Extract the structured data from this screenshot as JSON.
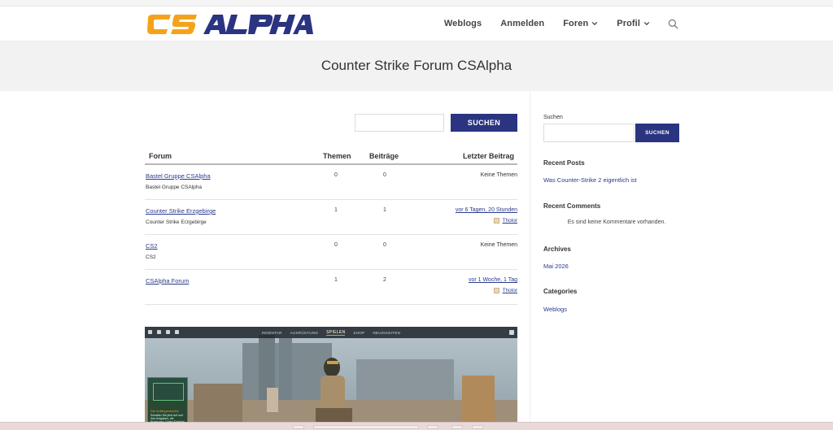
{
  "brand": {
    "logo_text": "CSALPHA",
    "colors": {
      "primary": "#2a3480",
      "accent": "#f5a21b"
    }
  },
  "nav": {
    "items": [
      {
        "label": "Weblogs",
        "has_dropdown": false
      },
      {
        "label": "Anmelden",
        "has_dropdown": false
      },
      {
        "label": "Foren",
        "has_dropdown": true
      },
      {
        "label": "Profil",
        "has_dropdown": true
      }
    ],
    "search_icon": "search-icon"
  },
  "page": {
    "title": "Counter Strike Forum CSAlpha"
  },
  "forum_search": {
    "placeholder": "",
    "button": "SUCHEN"
  },
  "forum_table": {
    "headers": {
      "forum": "Forum",
      "themen": "Themen",
      "beitraege": "Beiträge",
      "letzter": "Letzter Beitrag"
    },
    "rows": [
      {
        "name": "Bastel Gruppe CSAlpha",
        "desc": "Bastel Gruppe CSAlpha",
        "themen": "0",
        "beitraege": "0",
        "last": "Keine Themen",
        "author": ""
      },
      {
        "name": "Counter Strike Erzgebirge",
        "desc": "Counter Strike Erzgebirge",
        "themen": "1",
        "beitraege": "1",
        "last": "vor 6 Tagen, 20 Stunden",
        "author": "Tholor"
      },
      {
        "name": "CS2",
        "desc": "CS2",
        "themen": "0",
        "beitraege": "0",
        "last": "Keine Themen",
        "author": ""
      },
      {
        "name": "CSAlpha Forum",
        "desc": "",
        "themen": "1",
        "beitraege": "2",
        "last": "vor 1 Woche, 1 Tag",
        "author": "Tholor"
      }
    ]
  },
  "game_image": {
    "menu": [
      "INVENTAR",
      "AUSRÜSTUNG",
      "SPIELEN",
      "SHOP",
      "NEUIGKEITEN"
    ],
    "active_menu": "SPIELEN",
    "panel_title": "Die Anfängerwoche",
    "panel_text": "Schalten Sie jetzt auf und Ihre Aufgaben, die Ruhmrang, Daten Einträge pro Woche."
  },
  "sidebar": {
    "search_label": "Suchen",
    "search_button": "SUCHEN",
    "recent_posts_heading": "Recent Posts",
    "recent_posts": [
      "Was Counter-Strike 2 eigentlich ist"
    ],
    "recent_comments_heading": "Recent Comments",
    "recent_comments_empty": "Es sind keine Kommentare vorhanden.",
    "archives_heading": "Archives",
    "archives": [
      "Mai 2026"
    ],
    "categories_heading": "Categories",
    "categories": [
      "Weblogs"
    ]
  }
}
